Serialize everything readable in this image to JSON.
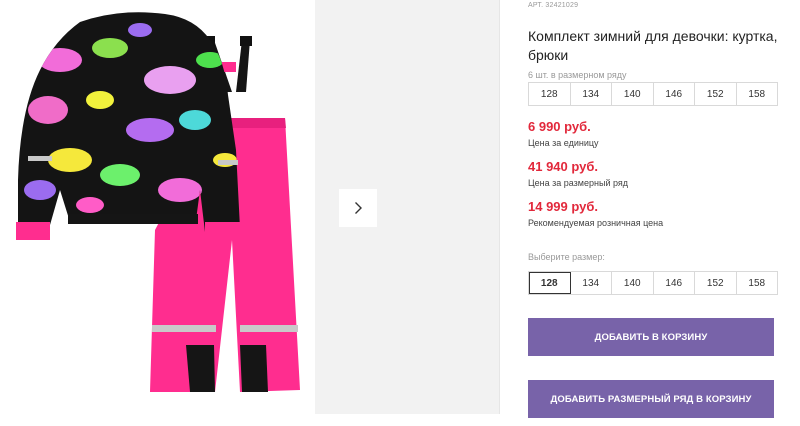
{
  "product": {
    "article": "АРТ. 32421029",
    "title": "Комплект зимний для девочки: куртка, брюки"
  },
  "range_note": "6 шт. в размерном ряду",
  "sizes": [
    "128",
    "134",
    "140",
    "146",
    "152",
    "158"
  ],
  "prices": {
    "unit_price": "6 990 руб.",
    "unit_label": "Цена за единицу",
    "range_price": "41 940 руб.",
    "range_label": "Цена за размерный ряд",
    "rrp_price": "14 999 руб.",
    "rrp_label": "Рекомендуемая розничная цена"
  },
  "size_select": {
    "label": "Выберите размер:",
    "selected": "128"
  },
  "buttons": {
    "add_to_cart": "ДОБАВИТЬ В КОРЗИНУ",
    "add_range_to_cart": "ДОБАВИТЬ РАЗМЕРНЫЙ РЯД В КОРЗИНУ"
  },
  "colors": {
    "price": "#e2283b",
    "button": "#7863a9",
    "jacket_base": "#141414",
    "pants": "#ff2d8f"
  },
  "icons": {
    "next": "chevron-right-icon"
  }
}
